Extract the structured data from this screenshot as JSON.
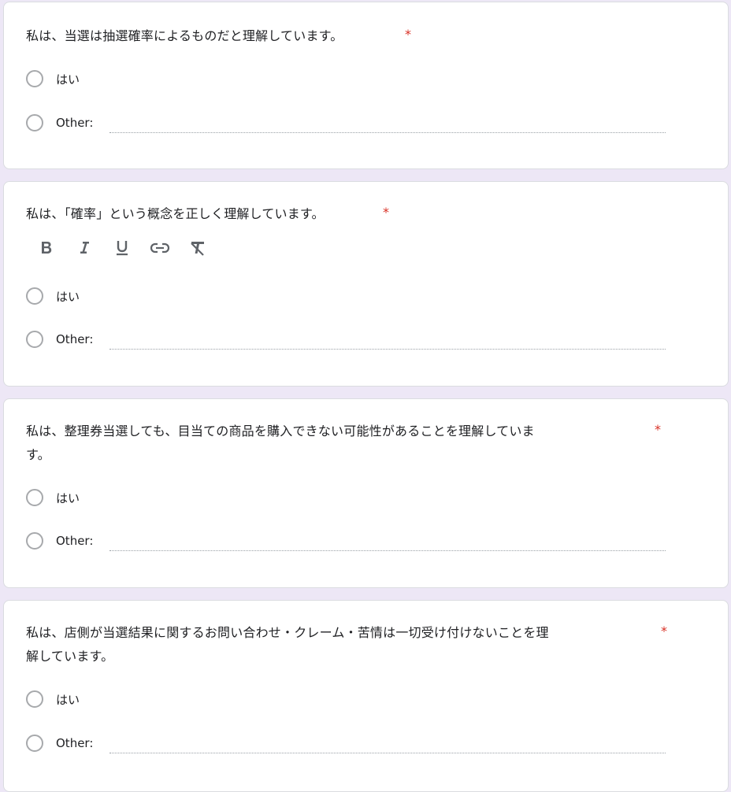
{
  "questions": [
    {
      "title": "私は、当選は抽選確率によるものだと理解しています。",
      "required_mark": "*",
      "options": [
        {
          "label": "はい"
        },
        {
          "label": "Other:"
        }
      ]
    },
    {
      "title": "私は、「確率」という概念を正しく理解しています。",
      "required_mark": "*",
      "toolbar": [
        "bold-icon",
        "italic-icon",
        "underline-icon",
        "link-icon",
        "clear-format-icon"
      ],
      "options": [
        {
          "label": "はい"
        },
        {
          "label": "Other:"
        }
      ]
    },
    {
      "title_line1": "私は、整理券当選しても、目当ての商品を購入できない可能性があることを理解していま",
      "title_line2": "す。",
      "required_mark": "*",
      "options": [
        {
          "label": "はい"
        },
        {
          "label": "Other:"
        }
      ]
    },
    {
      "title_line1": "私は、店側が当選結果に関するお問い合わせ・クレーム・苦情は一切受け付けないことを理",
      "title_line2": "解しています。",
      "required_mark": "*",
      "options": [
        {
          "label": "はい"
        },
        {
          "label": "Other:"
        }
      ]
    }
  ],
  "colors": {
    "background": "#ede7f6",
    "card": "#ffffff",
    "required": "#d93025"
  }
}
